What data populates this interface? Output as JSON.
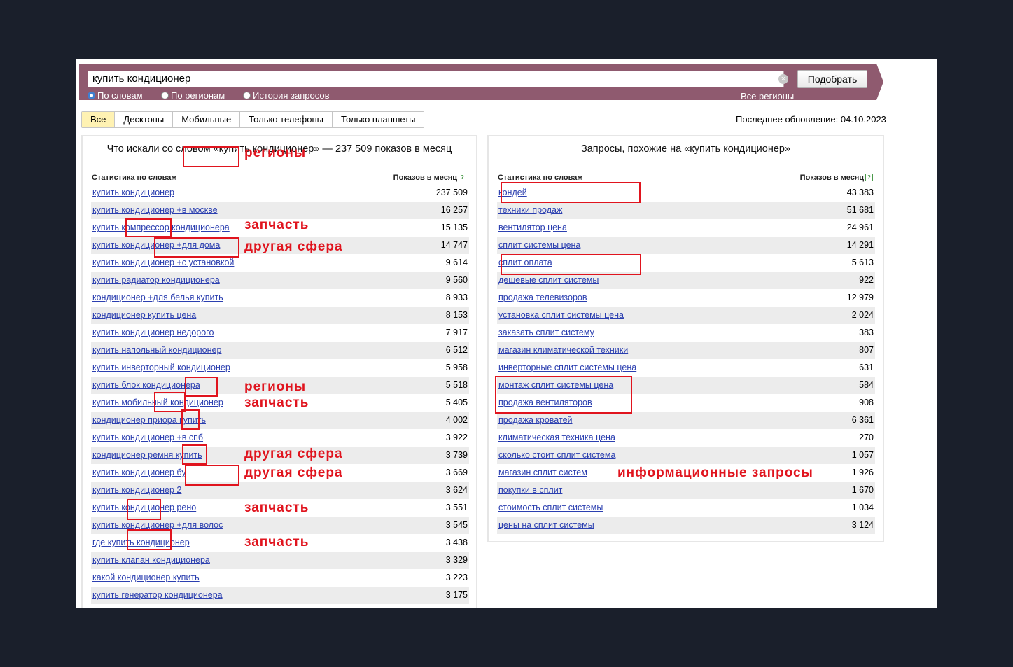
{
  "search": {
    "query": "купить кондиционер",
    "button_label": "Подобрать",
    "modes": [
      "По словам",
      "По регионам",
      "История запросов"
    ],
    "selected_mode": "По словам",
    "regions_link": "Все регионы"
  },
  "tabs": [
    "Все",
    "Десктопы",
    "Мобильные",
    "Только телефоны",
    "Только планшеты"
  ],
  "last_update": "Последнее обновление: 04.10.2023",
  "left_panel": {
    "title": "Что искали со словом «купить кондиционер» — 237 509 показов в месяц",
    "col_words": "Статистика по словам",
    "col_count": "Показов в месяц",
    "rows": [
      {
        "q": "купить кондиционер",
        "n": "237 509"
      },
      {
        "q": "купить кондиционер +в москве",
        "n": "16 257"
      },
      {
        "q": "купить компрессор кондиционера",
        "n": "15 135"
      },
      {
        "q": "купить кондиционер +для дома",
        "n": "14 747"
      },
      {
        "q": "купить кондиционер +с установкой",
        "n": "9 614"
      },
      {
        "q": "купить радиатор кондиционера",
        "n": "9 560"
      },
      {
        "q": "кондиционер +для белья купить",
        "n": "8 933"
      },
      {
        "q": "кондиционер купить цена",
        "n": "8 153"
      },
      {
        "q": "купить кондиционер недорого",
        "n": "7 917"
      },
      {
        "q": "купить напольный кондиционер",
        "n": "6 512"
      },
      {
        "q": "купить инверторный кондиционер",
        "n": "5 958"
      },
      {
        "q": "купить блок кондиционера",
        "n": "5 518"
      },
      {
        "q": "купить мобильный кондиционер",
        "n": "5 405"
      },
      {
        "q": "кондиционер приора купить",
        "n": "4 002"
      },
      {
        "q": "купить кондиционер +в спб",
        "n": "3 922"
      },
      {
        "q": "кондиционер ремня купить",
        "n": "3 739"
      },
      {
        "q": "купить кондиционер бу",
        "n": "3 669"
      },
      {
        "q": "купить кондиционер 2",
        "n": "3 624"
      },
      {
        "q": "купить кондиционер рено",
        "n": "3 551"
      },
      {
        "q": "купить кондиционер +для волос",
        "n": "3 545"
      },
      {
        "q": "где купить кондиционер",
        "n": "3 438"
      },
      {
        "q": "купить клапан кондиционера",
        "n": "3 329"
      },
      {
        "q": "какой кондиционер купить",
        "n": "3 223"
      },
      {
        "q": "купить генератор кондиционера",
        "n": "3 175"
      }
    ]
  },
  "right_panel": {
    "title": "Запросы, похожие на «купить кондиционер»",
    "col_words": "Статистика по словам",
    "col_count": "Показов в месяц",
    "rows": [
      {
        "q": "кондей",
        "n": "43 383"
      },
      {
        "q": "техники продаж",
        "n": "51 681"
      },
      {
        "q": "вентилятор цена",
        "n": "24 961"
      },
      {
        "q": "сплит системы цена",
        "n": "14 291"
      },
      {
        "q": "сплит оплата",
        "n": "5 613"
      },
      {
        "q": "дешевые сплит системы",
        "n": "922"
      },
      {
        "q": "продажа телевизоров",
        "n": "12 979"
      },
      {
        "q": "установка сплит системы цена",
        "n": "2 024"
      },
      {
        "q": "заказать сплит систему",
        "n": "383"
      },
      {
        "q": "магазин климатической техники",
        "n": "807"
      },
      {
        "q": "инверторные сплит системы цена",
        "n": "631"
      },
      {
        "q": "монтаж сплит системы цена",
        "n": "584"
      },
      {
        "q": "продажа вентиляторов",
        "n": "908"
      },
      {
        "q": "продажа кроватей",
        "n": "6 361"
      },
      {
        "q": "климатическая техника цена",
        "n": "270"
      },
      {
        "q": "сколько стоит сплит система",
        "n": "1 057"
      },
      {
        "q": "магазин сплит систем",
        "n": "1 926"
      },
      {
        "q": "покупки в сплит",
        "n": "1 670"
      },
      {
        "q": "стоимость сплит системы",
        "n": "1 034"
      },
      {
        "q": "цены на сплит системы",
        "n": "3 124"
      }
    ]
  },
  "annotations": {
    "regions": "регионы",
    "spare_part": "запчасть",
    "other_field": "другая сфера",
    "informational": "информационные запросы"
  }
}
